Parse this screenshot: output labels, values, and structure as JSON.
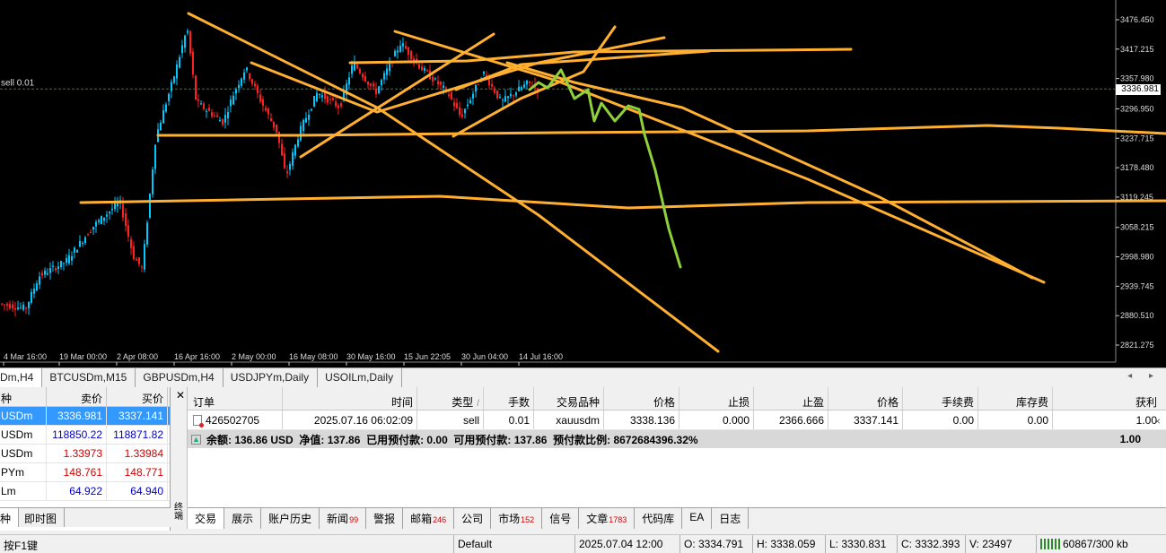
{
  "chart": {
    "order_line_label": "sell 0.01",
    "current_price": "3336.981",
    "price_axis": [
      "3476.450",
      "3417.215",
      "3357.980",
      "3296.950",
      "3237.715",
      "3178.480",
      "3119.245",
      "3058.215",
      "2998.980",
      "2939.745",
      "2880.510",
      "2821.275"
    ],
    "time_axis": [
      "4 Mar 16:00",
      "19 Mar 00:00",
      "2 Apr 08:00",
      "16 Apr 16:00",
      "2 May 00:00",
      "16 May 08:00",
      "30 May 16:00",
      "15 Jun 22:05",
      "30 Jun 04:00",
      "14 Jul 16:00"
    ],
    "colors": {
      "background": "#000000",
      "bull": "#00c8ff",
      "bear": "#ff2020",
      "trendline": "#ffb030",
      "projection": "#8fd13a",
      "grid_line": "#3a7a3a"
    }
  },
  "chart_tabs": [
    {
      "label": "Dm,H4",
      "active": true
    },
    {
      "label": "BTCUSDm,M15",
      "active": false
    },
    {
      "label": "GBPUSDm,H4",
      "active": false
    },
    {
      "label": "USDJPYm,Daily",
      "active": false
    },
    {
      "label": "USOILm,Daily",
      "active": false
    }
  ],
  "tab_scroll": "◂ ▸",
  "watch": {
    "headers": {
      "symbol": "种",
      "bid": "卖价",
      "ask": "买价"
    },
    "rows": [
      {
        "symbol": "USDm",
        "bid": "3336.981",
        "ask": "3337.141",
        "dir": "sel"
      },
      {
        "symbol": "USDm",
        "bid": "118850.22",
        "ask": "118871.82",
        "dir": "up"
      },
      {
        "symbol": "USDm",
        "bid": "1.33973",
        "ask": "1.33984",
        "dir": "dn"
      },
      {
        "symbol": "PYm",
        "bid": "148.761",
        "ask": "148.771",
        "dir": "dn"
      },
      {
        "symbol": "Lm",
        "bid": "64.922",
        "ask": "64.940",
        "dir": "up"
      }
    ],
    "tabs": [
      "种",
      "即时图"
    ]
  },
  "terminal_side": {
    "close": "✕",
    "label": "终端"
  },
  "terminal": {
    "headers": {
      "order": "订单",
      "time": "时间",
      "type": "类型",
      "sort": "/",
      "lots": "手数",
      "symbol": "交易品种",
      "price": "价格",
      "sl": "止损",
      "tp": "止盈",
      "price2": "价格",
      "commission": "手续费",
      "swap": "库存费",
      "profit": "获利"
    },
    "row": {
      "order": "426502705",
      "time": "2025.07.16 06:02:09",
      "type": "sell",
      "lots": "0.01",
      "symbol": "xauusdm",
      "price": "3338.136",
      "sl": "0.000",
      "tp": "2366.666",
      "price2": "3337.141",
      "commission": "0.00",
      "swap": "0.00",
      "profit": "1.00"
    },
    "summary": {
      "text": "余额: 136.86 USD  净值: 137.86  已用预付款: 0.00  可用预付款: 137.86  预付款比例: 8672684396.32%",
      "profit": "1.00"
    },
    "close_row": "×"
  },
  "terminal_tabs": [
    {
      "label": "交易",
      "badge": "",
      "active": true
    },
    {
      "label": "展示",
      "badge": ""
    },
    {
      "label": "账户历史",
      "badge": ""
    },
    {
      "label": "新闻",
      "badge": "99"
    },
    {
      "label": "警报",
      "badge": ""
    },
    {
      "label": "邮箱",
      "badge": "246"
    },
    {
      "label": "公司",
      "badge": ""
    },
    {
      "label": "市场",
      "badge": "152"
    },
    {
      "label": "信号",
      "badge": ""
    },
    {
      "label": "文章",
      "badge": "1783"
    },
    {
      "label": "代码库",
      "badge": ""
    },
    {
      "label": "EA",
      "badge": ""
    },
    {
      "label": "日志",
      "badge": ""
    }
  ],
  "status": {
    "help": "按F1键",
    "profile": "Default",
    "datetime": "2025.07.04 12:00",
    "open": "O: 3334.791",
    "high": "H: 3338.059",
    "low": "L: 3330.831",
    "close": "C: 3332.393",
    "volume": "V: 23497",
    "traffic": "60867/300 kb"
  }
}
